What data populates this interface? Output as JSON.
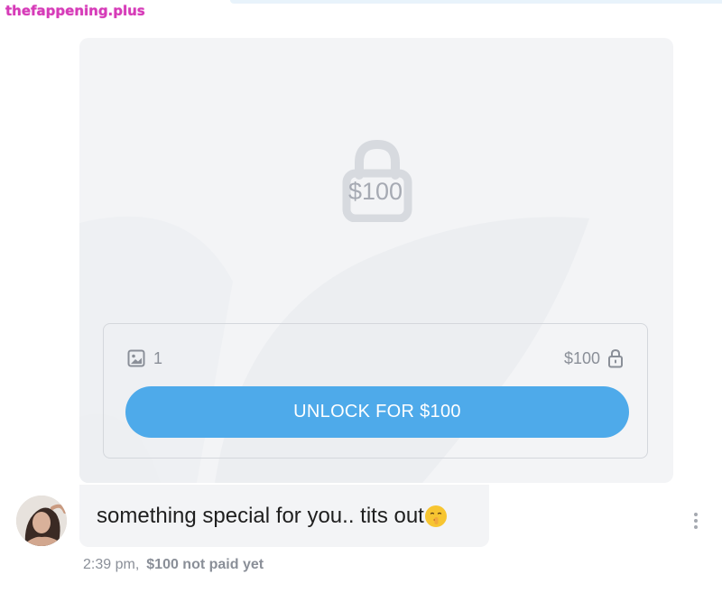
{
  "watermark": "thefappening.plus",
  "media": {
    "locked_price": "$100",
    "media_count": "1",
    "price": "$100",
    "unlock_button_label": "UNLOCK FOR $100"
  },
  "message": {
    "text": "something special for you.. tits out"
  },
  "meta": {
    "time": "2:39 pm,",
    "status": "$100 not paid yet"
  },
  "icons": {
    "image": "image-icon",
    "lock": "lock-icon",
    "emoji": "shushing-face-emoji",
    "more": "more-vertical-icon"
  },
  "colors": {
    "accent": "#4eaaea",
    "card_bg": "#f3f4f6",
    "muted_text": "#8a8f98",
    "watermark": "#d63bb8"
  }
}
